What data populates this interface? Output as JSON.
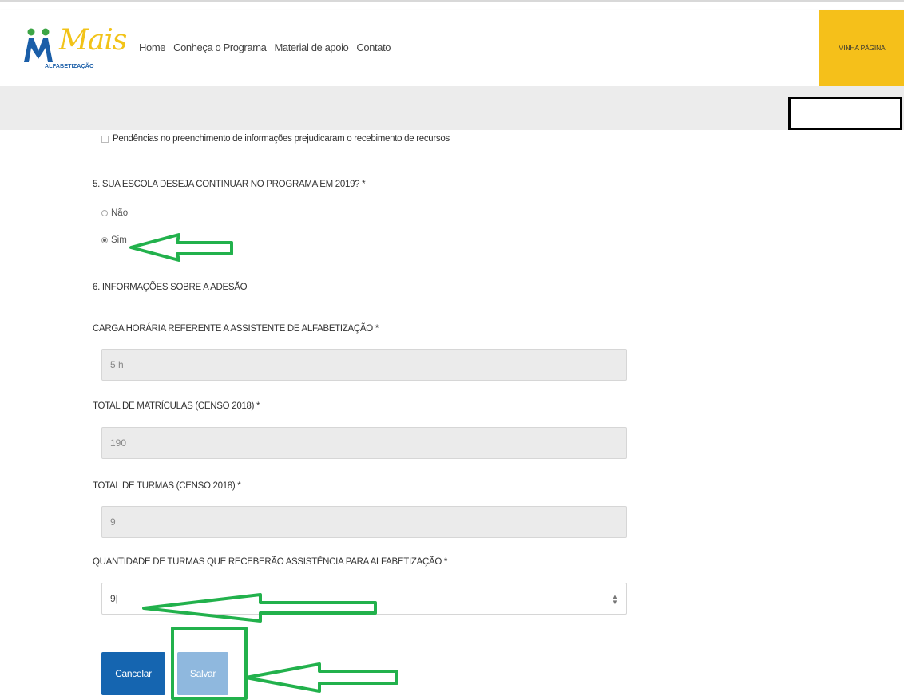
{
  "header": {
    "logo_brand": "Mais",
    "logo_sub": "ALFABETIZAÇÃO",
    "nav": [
      "Home",
      "Conheça o Programa",
      "Material de apoio",
      "Contato"
    ],
    "minha_pagina": "MINHA PÁGINA",
    "brand_color": "#f5c01a"
  },
  "form": {
    "checkbox_label": "Pendências no preenchimento de informações prejudicaram o recebimento de recursos",
    "q5_title": "5. SUA ESCOLA DESEJA CONTINUAR NO PROGRAMA EM 2019? *",
    "q5_options": [
      {
        "label": "Não",
        "checked": false
      },
      {
        "label": "Sim",
        "checked": true
      }
    ],
    "q6_title": "6. INFORMAÇÕES SOBRE A ADESÃO",
    "fields": [
      {
        "label": "CARGA HORÁRIA REFERENTE A ASSISTENTE DE ALFABETIZAÇÃO *",
        "value": "5 h"
      },
      {
        "label": "TOTAL DE MATRÍCULAS (CENSO 2018) *",
        "value": "190"
      },
      {
        "label": "TOTAL DE TURMAS (CENSO 2018) *",
        "value": "9"
      },
      {
        "label": "QUANTIDADE DE TURMAS QUE RECEBERÃO ASSISTÊNCIA PARA ALFABETIZAÇÃO *",
        "value": "9|"
      }
    ],
    "cancel_label": "Cancelar",
    "save_label": "Salvar"
  },
  "colors": {
    "cancel_bg": "#1565b0",
    "save_bg": "#8fb8de",
    "annotation_green": "#22b14c"
  }
}
